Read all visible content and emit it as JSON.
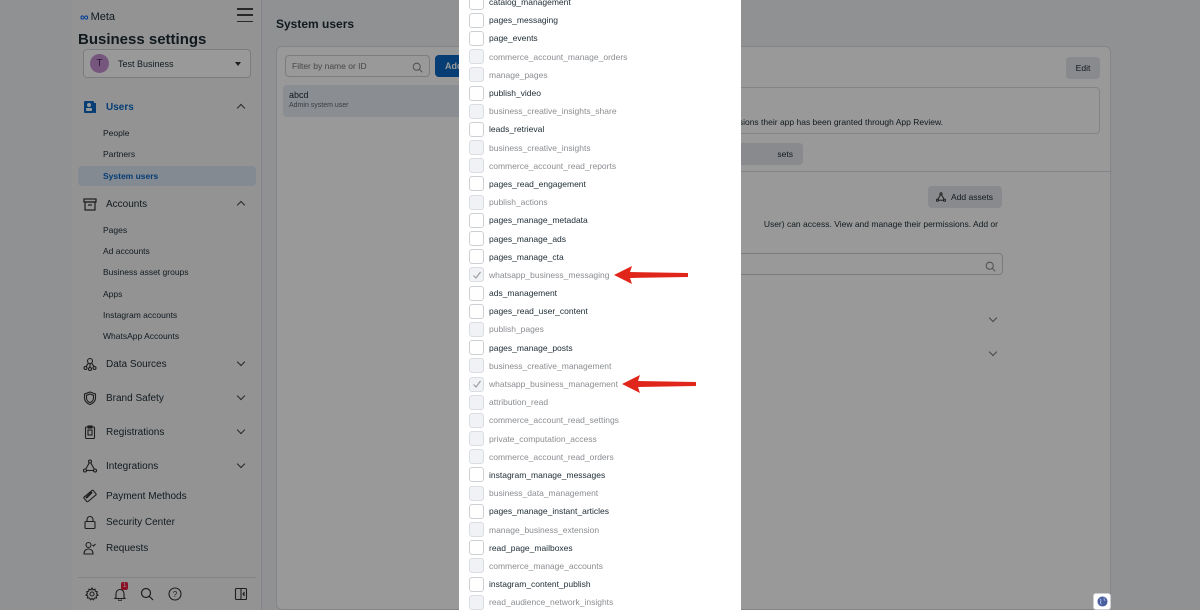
{
  "sidebar": {
    "brand": "Meta",
    "title": "Business settings",
    "business": {
      "initial": "T",
      "name": "Test Business"
    },
    "sections": {
      "users": {
        "label": "Users",
        "items": [
          "People",
          "Partners",
          "System users"
        ]
      },
      "accounts": {
        "label": "Accounts",
        "items": [
          "Pages",
          "Ad accounts",
          "Business asset groups",
          "Apps",
          "Instagram accounts",
          "WhatsApp Accounts"
        ]
      },
      "data_sources": {
        "label": "Data Sources"
      },
      "brand_safety": {
        "label": "Brand Safety"
      },
      "registrations": {
        "label": "Registrations"
      },
      "integrations": {
        "label": "Integrations"
      },
      "payment_methods": {
        "label": "Payment Methods"
      },
      "security_center": {
        "label": "Security Center"
      },
      "requests": {
        "label": "Requests"
      }
    },
    "footer": {
      "notification_count": "1"
    }
  },
  "main": {
    "page_title": "System users",
    "filter_placeholder": "Filter by name or ID",
    "add_button": "Add",
    "selected_user": {
      "name": "abcd",
      "role": "Admin system user"
    },
    "edit_button": "Edit",
    "info_text": "sions their app has been granted through App Review.",
    "assets_tab": "sets",
    "add_assets_button": "Add assets",
    "assets_description": "User) can access. View and manage their permissions. Add or"
  },
  "permissions": [
    {
      "name": "catalog_management",
      "enabled": true,
      "checked": false
    },
    {
      "name": "pages_messaging",
      "enabled": true,
      "checked": false
    },
    {
      "name": "page_events",
      "enabled": true,
      "checked": false
    },
    {
      "name": "commerce_account_manage_orders",
      "enabled": false,
      "checked": false
    },
    {
      "name": "manage_pages",
      "enabled": false,
      "checked": false
    },
    {
      "name": "publish_video",
      "enabled": true,
      "checked": false
    },
    {
      "name": "business_creative_insights_share",
      "enabled": false,
      "checked": false
    },
    {
      "name": "leads_retrieval",
      "enabled": true,
      "checked": false
    },
    {
      "name": "business_creative_insights",
      "enabled": false,
      "checked": false
    },
    {
      "name": "commerce_account_read_reports",
      "enabled": false,
      "checked": false
    },
    {
      "name": "pages_read_engagement",
      "enabled": true,
      "checked": false
    },
    {
      "name": "publish_actions",
      "enabled": false,
      "checked": false
    },
    {
      "name": "pages_manage_metadata",
      "enabled": true,
      "checked": false
    },
    {
      "name": "pages_manage_ads",
      "enabled": true,
      "checked": false
    },
    {
      "name": "pages_manage_cta",
      "enabled": true,
      "checked": false
    },
    {
      "name": "whatsapp_business_messaging",
      "enabled": false,
      "checked": true,
      "highlighted": true
    },
    {
      "name": "ads_management",
      "enabled": true,
      "checked": false
    },
    {
      "name": "pages_read_user_content",
      "enabled": true,
      "checked": false
    },
    {
      "name": "publish_pages",
      "enabled": false,
      "checked": false
    },
    {
      "name": "pages_manage_posts",
      "enabled": true,
      "checked": false
    },
    {
      "name": "business_creative_management",
      "enabled": false,
      "checked": false
    },
    {
      "name": "whatsapp_business_management",
      "enabled": false,
      "checked": true,
      "highlighted": true
    },
    {
      "name": "attribution_read",
      "enabled": false,
      "checked": false
    },
    {
      "name": "commerce_account_read_settings",
      "enabled": false,
      "checked": false
    },
    {
      "name": "private_computation_access",
      "enabled": false,
      "checked": false
    },
    {
      "name": "commerce_account_read_orders",
      "enabled": false,
      "checked": false
    },
    {
      "name": "instagram_manage_messages",
      "enabled": true,
      "checked": false
    },
    {
      "name": "business_data_management",
      "enabled": false,
      "checked": false
    },
    {
      "name": "pages_manage_instant_articles",
      "enabled": true,
      "checked": false
    },
    {
      "name": "manage_business_extension",
      "enabled": false,
      "checked": false
    },
    {
      "name": "read_page_mailboxes",
      "enabled": true,
      "checked": false
    },
    {
      "name": "commerce_manage_accounts",
      "enabled": false,
      "checked": false
    },
    {
      "name": "instagram_content_publish",
      "enabled": true,
      "checked": false
    },
    {
      "name": "read_audience_network_insights",
      "enabled": false,
      "checked": false
    }
  ],
  "annotation_color": "#e0261b"
}
